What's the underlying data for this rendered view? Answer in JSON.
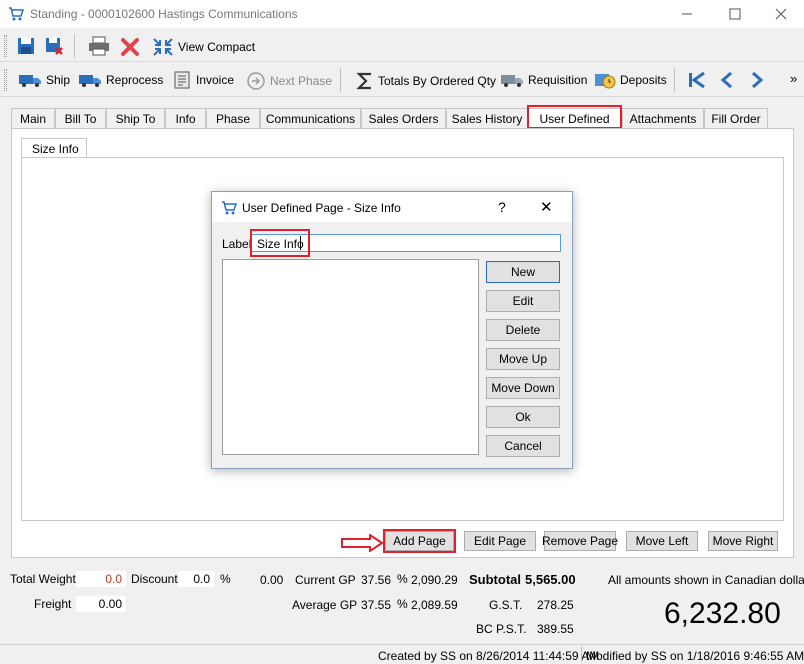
{
  "window": {
    "title": "Standing - 0000102600 Hastings Communications"
  },
  "toolbar1": {
    "view_compact": "View Compact"
  },
  "toolbar2": {
    "ship": "Ship",
    "reprocess": "Reprocess",
    "invoice": "Invoice",
    "next_phase": "Next Phase",
    "totals": "Totals By Ordered Qty",
    "requisition": "Requisition",
    "deposits": "Deposits",
    "overflow": "»"
  },
  "tabs": [
    "Main",
    "Bill To",
    "Ship To",
    "Info",
    "Phase",
    "Communications",
    "Sales Orders",
    "Sales History",
    "User Defined",
    "Attachments",
    "Fill Order"
  ],
  "subtab": "Size Info",
  "dialog": {
    "title": "User Defined Page - Size Info",
    "help": "?",
    "close": "✕",
    "label": "Label",
    "label_value": "Size Info",
    "buttons": {
      "new": "New",
      "edit": "Edit",
      "delete": "Delete",
      "move_up": "Move Up",
      "move_down": "Move Down",
      "ok": "Ok",
      "cancel": "Cancel"
    }
  },
  "page_buttons": {
    "add_page": "Add Page",
    "edit_page": "Edit Page",
    "remove_page": "Remove Page",
    "move_left": "Move Left",
    "move_right": "Move Right"
  },
  "totals": {
    "total_weight_label": "Total Weight",
    "total_weight": "0.0",
    "discount_label": "Discount",
    "discount": "0.0",
    "percent": "%",
    "discount_amount": "0.00",
    "freight_label": "Freight",
    "freight": "0.00",
    "current_gp_label": "Current GP",
    "current_gp_pct": "37.56",
    "current_gp_amount": "2,090.29",
    "average_gp_label": "Average GP",
    "average_gp_pct": "37.55",
    "average_gp_amount": "2,089.59",
    "subtotal_label": "Subtotal",
    "subtotal": "5,565.00",
    "gst_label": "G.S.T.",
    "gst": "278.25",
    "pst_label": "BC P.S.T.",
    "pst": "389.55",
    "currency_note": "All amounts shown in Canadian dollars.",
    "grand_total": "6,232.80"
  },
  "status": {
    "created": "Created by SS on 8/26/2014 11:44:59 AM",
    "modified": "Modified by SS on 1/18/2016 9:46:55 AM"
  },
  "colors": {
    "highlight": "#e0202c",
    "accent": "#2a6ebb",
    "negative": "#c0392b"
  }
}
